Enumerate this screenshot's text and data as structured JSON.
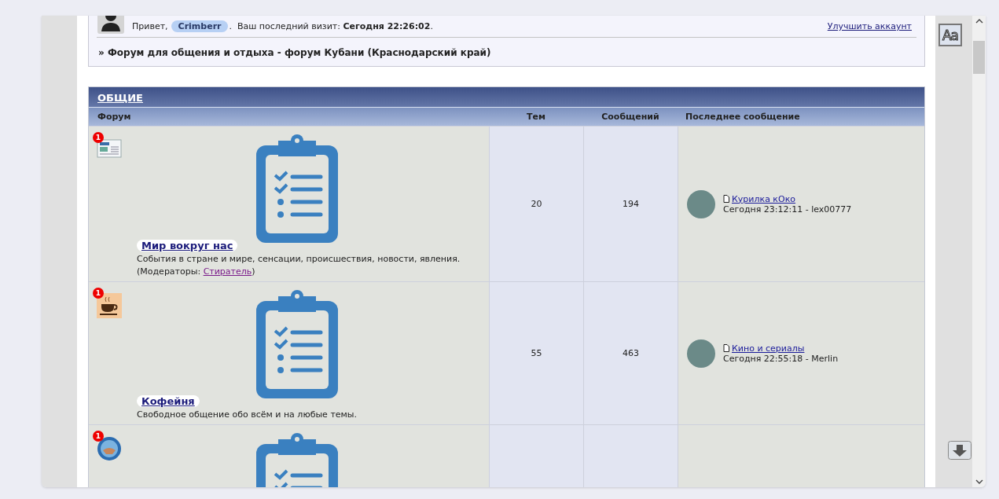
{
  "user_panel": {
    "greeting": "Привет,",
    "username": "Crimberr",
    "visit_text": ".  Ваш последний визит: **Сегодня 22:26:02**.",
    "upgrade_link": "Улучшить аккаунт",
    "breadcrumb": "» Форум для общения и отдыха - форум Кубани (Краснодарский край)"
  },
  "side_tools": {
    "font_button": "Aa"
  },
  "category": {
    "title": "ОБЩИЕ",
    "columns": [
      "Форум",
      "Тем",
      "Сообщений",
      "Последнее сообщение"
    ],
    "forums": [
      {
        "kind": "news",
        "badge": "1",
        "name": "Мир вокруг нас",
        "description": "События в стране и мире, сенсации, происшествия, новости, явления.",
        "moderators_label": "(Модераторы: ",
        "moderator": "Стиратель",
        "moderators_end": ")",
        "topics": "20",
        "posts": "194",
        "last_post": {
          "title": "Курилка кОко",
          "info": "Сегодня 23:12:11 - lex00777"
        }
      },
      {
        "kind": "coffee",
        "badge": "1",
        "name": "Кофейня",
        "description": "Свободное общение обо всём и на любые темы.",
        "topics": "55",
        "posts": "463",
        "last_post": {
          "title": "Кино и сериалы",
          "info": "Сегодня 22:55:18 - Merlin"
        }
      },
      {
        "kind": "globe",
        "badge": "1"
      }
    ]
  }
}
